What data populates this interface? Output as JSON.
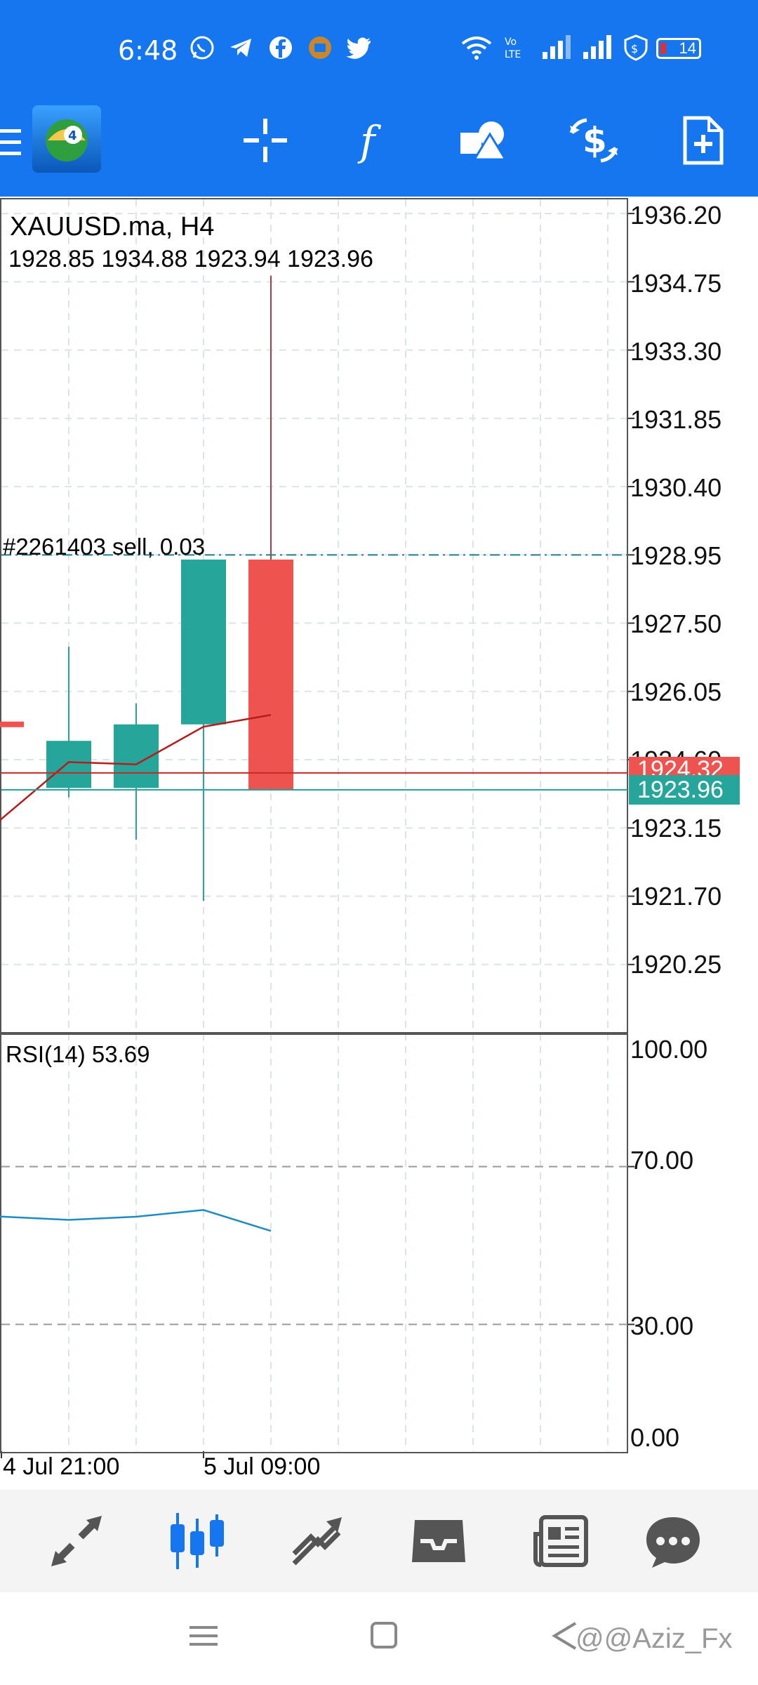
{
  "status_bar": {
    "time": "6:48",
    "app_icons": [
      "whatsapp-icon",
      "telegram-icon",
      "facebook-icon",
      "app-icon",
      "twitter-icon"
    ],
    "system_icons": [
      "wifi-icon",
      "volte-icon",
      "signal-icon",
      "signal-icon",
      "shield-icon"
    ],
    "battery": "14"
  },
  "toolbar": {
    "icons": [
      "crosshair-icon",
      "function-icon",
      "shapes-icon",
      "dollar-exchange-icon",
      "new-document-icon"
    ]
  },
  "chart": {
    "symbol": "XAUUSD.ma, H4",
    "ohlc": "1928.85 1934.88 1923.94 1923.96",
    "order_label": "#2261403 sell, 0.03",
    "price_axis": [
      "1936.20",
      "1934.75",
      "1933.30",
      "1931.85",
      "1930.40",
      "1928.95",
      "1927.50",
      "1926.05",
      "1924.60",
      "1923.15",
      "1921.70",
      "1920.25"
    ],
    "bid_price": "1923.96",
    "ask_price": "1924.32",
    "time_labels": [
      "4 Jul 21:00",
      "5 Jul 09:00"
    ],
    "rsi_label": "RSI(14) 53.69",
    "rsi_axis": [
      "100.00",
      "70.00",
      "30.00",
      "0.00"
    ],
    "colors": {
      "bull": "#26a69a",
      "bear": "#ef5350",
      "ma": "#b71c1c",
      "rsi": "#1e8bc3",
      "grid": "#dde3ea"
    }
  },
  "chart_data": {
    "type": "candlestick",
    "price_axis_range": [
      1918.8,
      1936.5
    ],
    "candles": [
      {
        "index": 1,
        "open": 1924.0,
        "high": 1927.0,
        "low": 1923.8,
        "close": 1925.0
      },
      {
        "index": 2,
        "open": 1924.0,
        "high": 1925.8,
        "low": 1922.9,
        "close": 1925.35
      },
      {
        "index": 3,
        "open": 1925.35,
        "high": 1928.85,
        "low": 1921.6,
        "close": 1928.85
      },
      {
        "index": 4,
        "open": 1928.85,
        "high": 1934.88,
        "low": 1923.94,
        "close": 1923.96
      }
    ],
    "partial_candle": {
      "index": 0,
      "price": 1925.35
    },
    "moving_average": [
      {
        "x": -0.2,
        "y": 1923.1
      },
      {
        "x": 1,
        "y": 1924.55
      },
      {
        "x": 2,
        "y": 1924.5
      },
      {
        "x": 3,
        "y": 1925.3
      },
      {
        "x": 4,
        "y": 1925.55
      }
    ],
    "order_line_price": 1928.95,
    "bid_price": 1923.96,
    "ask_price": 1924.32,
    "rsi": {
      "period": 14,
      "current": 53.69,
      "range": [
        0,
        100
      ],
      "levels": [
        70,
        30
      ],
      "values": [
        {
          "x": -0.2,
          "y": 57.5
        },
        {
          "x": 1,
          "y": 56.5
        },
        {
          "x": 2,
          "y": 57.3
        },
        {
          "x": 3,
          "y": 59.0
        },
        {
          "x": 4,
          "y": 53.69
        }
      ]
    }
  },
  "bottom_nav": {
    "icons": [
      "quotes-icon",
      "chart-icon",
      "trade-icon",
      "history-icon",
      "news-icon",
      "messages-icon"
    ],
    "active_index": 1
  },
  "watermark": "@@Aziz_Fx"
}
